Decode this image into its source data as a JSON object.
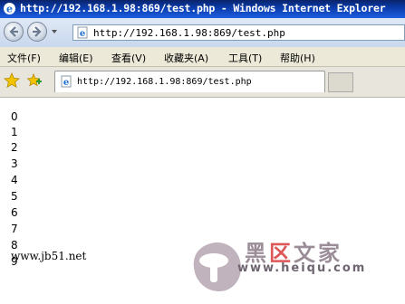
{
  "window": {
    "title": "http://192.168.1.98:869/test.php - Windows Internet Explorer"
  },
  "address_bar": {
    "url": "http://192.168.1.98:869/test.php"
  },
  "menu": {
    "items": [
      {
        "label": "文件(F)"
      },
      {
        "label": "编辑(E)"
      },
      {
        "label": "查看(V)"
      },
      {
        "label": "收藏夹(A)"
      },
      {
        "label": "工具(T)"
      },
      {
        "label": "帮助(H)"
      }
    ]
  },
  "tab": {
    "title": "http://192.168.1.98:869/test.php"
  },
  "content": {
    "numbers": [
      "0",
      "1",
      "2",
      "3",
      "4",
      "5",
      "6",
      "7",
      "8",
      "9"
    ],
    "footer": "www.jb51.net"
  },
  "watermark": {
    "brand_left": "黑",
    "brand_accent": "区",
    "brand_right": "文家",
    "url": "www.heiqu.com"
  },
  "icons": {
    "back": "back-arrow-icon",
    "forward": "forward-arrow-icon",
    "page": "ie-page-icon",
    "favorites": "star-icon",
    "add_favorite": "add-favorite-icon"
  },
  "colors": {
    "titlebar": "#0a3aa8",
    "menubar": "#ece9d8",
    "accent_red": "#d83a3a"
  }
}
